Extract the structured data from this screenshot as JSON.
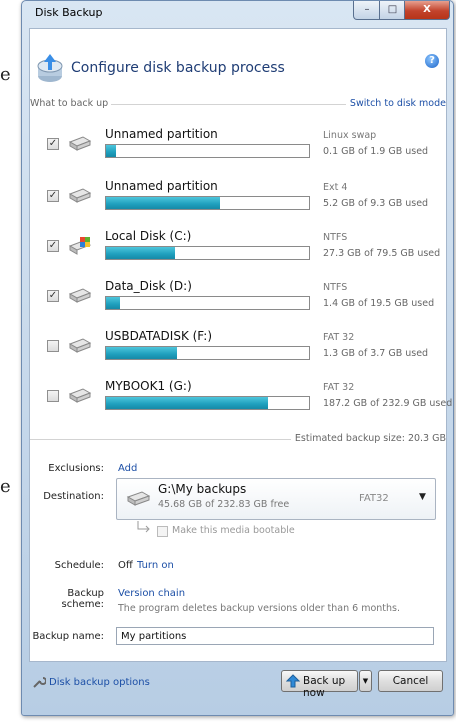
{
  "background": {
    "frag1": "e",
    "frag2": "e"
  },
  "window": {
    "title": "Disk Backup",
    "controls": {
      "minimize": "–",
      "maximize": "□",
      "close": "X"
    }
  },
  "header": {
    "title": "Configure disk backup process",
    "help": "?"
  },
  "what_to_back_up": {
    "label": "What to back up",
    "switch_link": "Switch to disk mode"
  },
  "partitions": [
    {
      "name": "Unnamed partition",
      "fs": "Linux swap",
      "used_text": "0.1 GB of 1.9 GB used",
      "used_fraction": 0.05,
      "checked": true,
      "icon": "hard-drive-icon"
    },
    {
      "name": "Unnamed partition",
      "fs": "Ext 4",
      "used_text": "5.2 GB of 9.3 GB used",
      "used_fraction": 0.56,
      "checked": true,
      "icon": "hard-drive-icon"
    },
    {
      "name": "Local Disk (C:)",
      "fs": "NTFS",
      "used_text": "27.3 GB of 79.5 GB used",
      "used_fraction": 0.34,
      "checked": true,
      "icon": "windows-drive-icon"
    },
    {
      "name": "Data_Disk (D:)",
      "fs": "NTFS",
      "used_text": "1.4 GB of 19.5 GB used",
      "used_fraction": 0.07,
      "checked": true,
      "icon": "hard-drive-icon"
    },
    {
      "name": "USBDATADISK (F:)",
      "fs": "FAT 32",
      "used_text": "1.3 GB of 3.7 GB used",
      "used_fraction": 0.35,
      "checked": false,
      "icon": "hard-drive-icon"
    },
    {
      "name": "MYBOOK1 (G:)",
      "fs": "FAT 32",
      "used_text": "187.2 GB of 232.9 GB used",
      "used_fraction": 0.8,
      "checked": false,
      "icon": "hard-drive-icon"
    }
  ],
  "checkmark": "✓",
  "estimated": {
    "label": "Estimated backup size:",
    "value": "20.3 GB"
  },
  "exclusions": {
    "label": "Exclusions:",
    "link": "Add"
  },
  "destination": {
    "label": "Destination:",
    "path": "G:\\My backups",
    "free": "45.68 GB of 232.83 GB free",
    "fs": "FAT32",
    "bootable_label": "Make this media bootable"
  },
  "schedule": {
    "label": "Schedule:",
    "status": "Off",
    "link": "Turn on"
  },
  "backup_scheme": {
    "label": "Backup scheme:",
    "link": "Version chain",
    "note": "The program deletes backup versions older than 6 months."
  },
  "backup_name": {
    "label": "Backup name:",
    "value": "My partitions"
  },
  "footer": {
    "options_link": "Disk backup options",
    "backup_now": "Back up now",
    "cancel": "Cancel"
  }
}
